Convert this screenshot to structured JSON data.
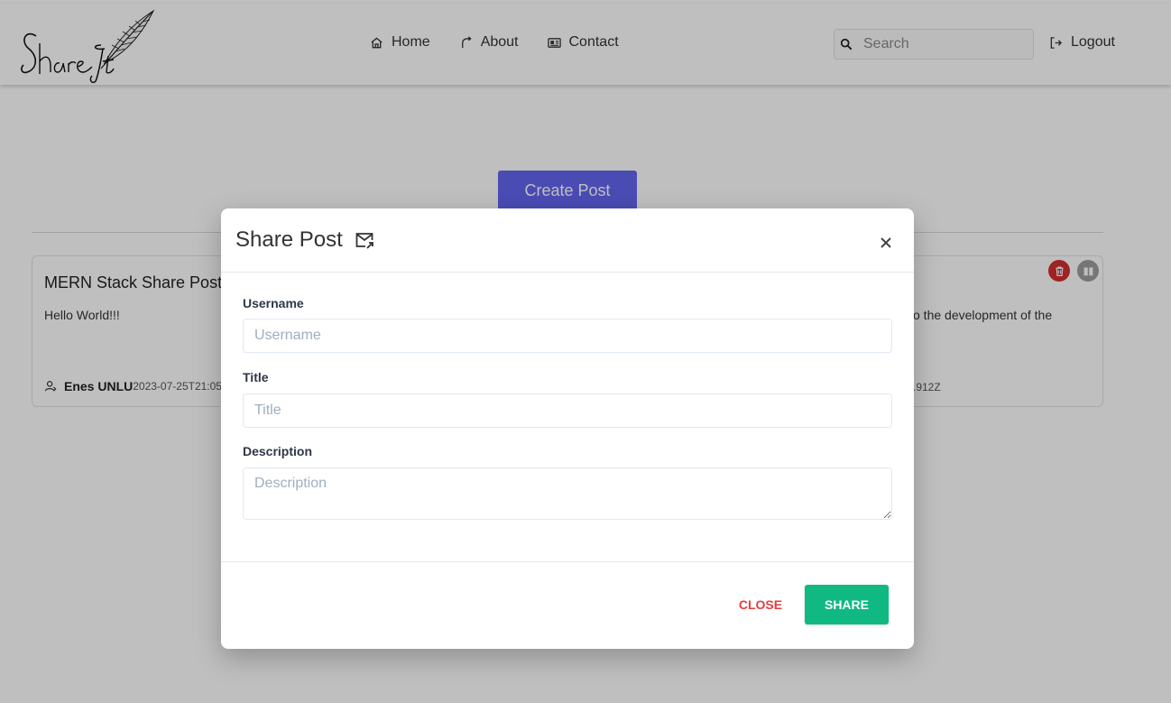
{
  "navbar": {
    "logo_text": "Share It",
    "links": [
      {
        "label": "Home",
        "icon": "home-icon"
      },
      {
        "label": "About",
        "icon": "about-icon"
      },
      {
        "label": "Contact",
        "icon": "contact-card-icon"
      }
    ],
    "search": {
      "placeholder": "Search",
      "value": ""
    },
    "logout_label": "Logout"
  },
  "main": {
    "create_button_label": "Create Post",
    "post": {
      "title": "MERN Stack Share Post",
      "body_left": "Hello World!!!",
      "body_right": "o the development of the",
      "author": "Enes UNLU",
      "date_left": "2023-07-25T21:05:3",
      "date_right": ".912Z"
    }
  },
  "modal": {
    "title": "Share Post",
    "title_icon": "mail-share-icon",
    "close_icon": "close-icon",
    "fields": {
      "username": {
        "label": "Username",
        "placeholder": "Username",
        "value": ""
      },
      "title": {
        "label": "Title",
        "placeholder": "Title",
        "value": ""
      },
      "description": {
        "label": "Description",
        "placeholder": "Description",
        "value": ""
      }
    },
    "buttons": {
      "close": "CLOSE",
      "share": "SHARE"
    }
  },
  "colors": {
    "primary": "#6366f1",
    "share": "#10b981",
    "close_text": "#e53e3e",
    "delete": "#d32f2f",
    "edit": "#9e9e9e"
  }
}
